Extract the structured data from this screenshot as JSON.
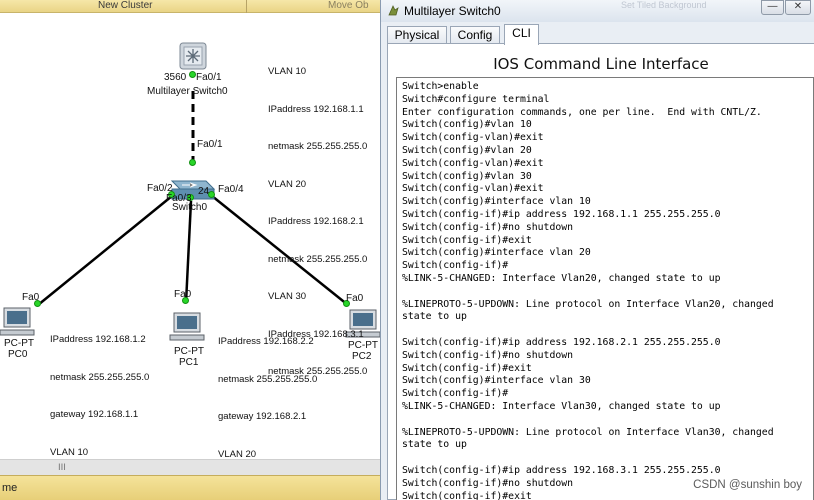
{
  "workspace": {
    "cluster_label": "New Cluster",
    "move_object_label": "Move Ob",
    "status_text": "me",
    "scroll_grip": "III"
  },
  "devices": {
    "multilayer": {
      "model": "3560",
      "name": "Multilayer Switch0",
      "port": "Fa0/1"
    },
    "switch": {
      "model": "24",
      "name": "Switch0",
      "port_up": "Fa0/1",
      "port_left": "Fa0/2",
      "port_mid": "Fa0/3",
      "port_right": "Fa0/4"
    },
    "pc0": {
      "model": "PC-PT",
      "name": "PC0",
      "port": "Fa0"
    },
    "pc1": {
      "model": "PC-PT",
      "name": "PC1",
      "port": "Fa0"
    },
    "pc2": {
      "model": "PC-PT",
      "name": "PC2",
      "port": "Fa0"
    }
  },
  "notes": {
    "multilayer": [
      "VLAN 10",
      "IPaddress 192.168.1.1",
      "netmask 255.255.255.0",
      "VLAN 20",
      "IPaddress 192.168.2.1",
      "netmask 255.255.255.0",
      "VLAN 30",
      "IPaddress 192.168.3.1",
      "netmask 255.255.255.0"
    ],
    "pc0": [
      "IPaddress 192.168.1.2",
      "netmask 255.255.255.0",
      "gateway 192.168.1.1",
      "VLAN 10"
    ],
    "pc1": [
      "IPaddress 192.168.2.2",
      "netmask 255.255.255.0",
      "gateway 192.168.2.1",
      "VLAN 20"
    ]
  },
  "window": {
    "title": "Multilayer Switch0",
    "ghost_title": "Set Tiled Background",
    "min_label": "—",
    "close_label": "✕",
    "tabs": [
      "Physical",
      "Config",
      "CLI"
    ],
    "active_tab": "CLI",
    "cli_heading": "IOS Command Line Interface",
    "cli_lines": [
      "Switch>enable",
      "Switch#configure terminal",
      "Enter configuration commands, one per line.  End with CNTL/Z.",
      "Switch(config)#vlan 10",
      "Switch(config-vlan)#exit",
      "Switch(config)#vlan 20",
      "Switch(config-vlan)#exit",
      "Switch(config)#vlan 30",
      "Switch(config-vlan)#exit",
      "Switch(config)#interface vlan 10",
      "Switch(config-if)#ip address 192.168.1.1 255.255.255.0",
      "Switch(config-if)#no shutdown",
      "Switch(config-if)#exit",
      "Switch(config)#interface vlan 20",
      "Switch(config-if)#",
      "%LINK-5-CHANGED: Interface Vlan20, changed state to up",
      "",
      "%LINEPROTO-5-UPDOWN: Line protocol on Interface Vlan20, changed",
      "state to up",
      "",
      "Switch(config-if)#ip address 192.168.2.1 255.255.255.0",
      "Switch(config-if)#no shutdown",
      "Switch(config-if)#exit",
      "Switch(config)#interface vlan 30",
      "Switch(config-if)#",
      "%LINK-5-CHANGED: Interface Vlan30, changed state to up",
      "",
      "%LINEPROTO-5-UPDOWN: Line protocol on Interface Vlan30, changed",
      "state to up",
      "",
      "Switch(config-if)#ip address 192.168.3.1 255.255.255.0",
      "Switch(config-if)#no shutdown",
      "Switch(config-if)#exit"
    ]
  },
  "watermark": "CSDN @sunshin boy",
  "colors": {
    "link_up": "#29d629",
    "cable": "#000000",
    "status_bar": "#f0dc8c"
  }
}
